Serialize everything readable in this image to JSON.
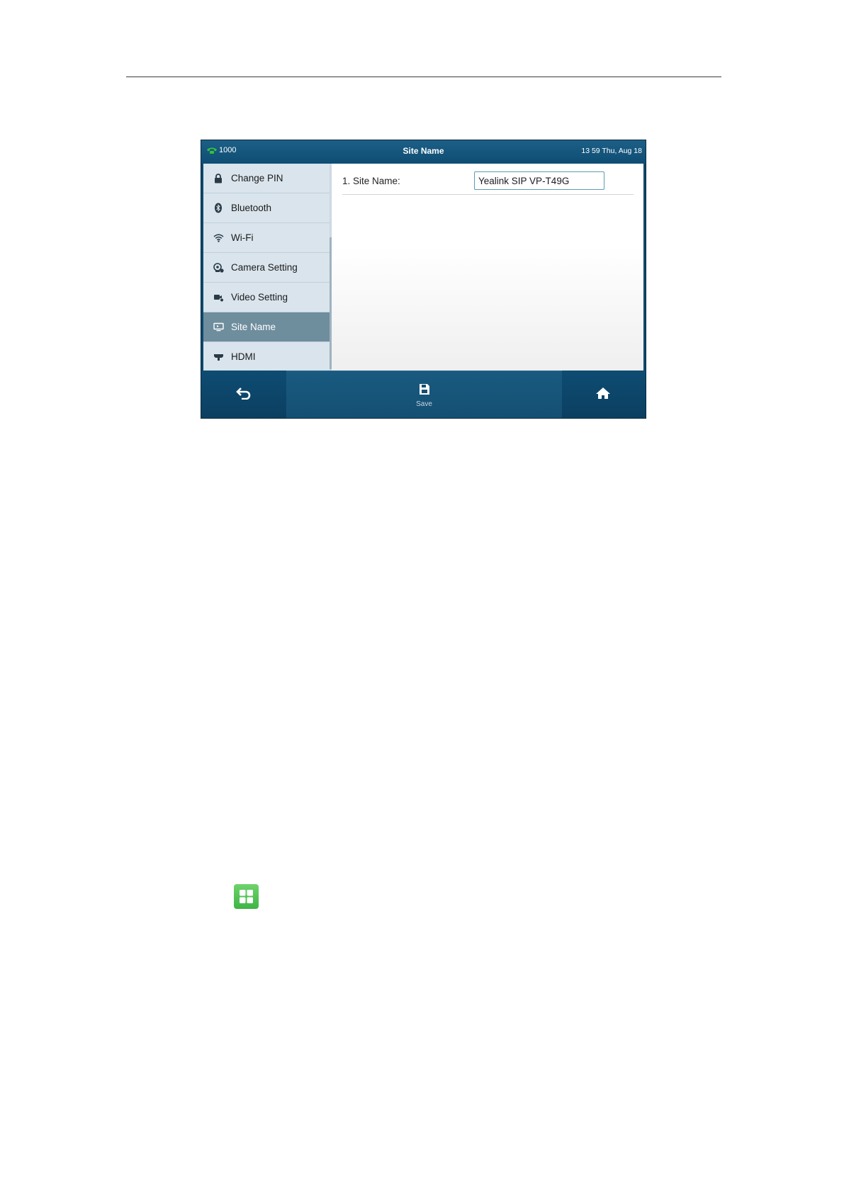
{
  "status_bar": {
    "line_number": "1000",
    "title": "Site Name",
    "datetime": "13 59 Thu, Aug 18"
  },
  "sidebar": {
    "items": [
      {
        "label": "Change PIN",
        "icon": "lock-icon"
      },
      {
        "label": "Bluetooth",
        "icon": "bluetooth-icon"
      },
      {
        "label": "Wi-Fi",
        "icon": "wifi-icon"
      },
      {
        "label": "Camera Setting",
        "icon": "camera-icon"
      },
      {
        "label": "Video Setting",
        "icon": "video-icon"
      },
      {
        "label": "Site Name",
        "icon": "monitor-icon",
        "active": true
      },
      {
        "label": "HDMI",
        "icon": "hdmi-icon"
      }
    ]
  },
  "form": {
    "site_name_label": "1. Site Name:",
    "site_name_value": "Yealink SIP VP-T49G"
  },
  "softkeys": {
    "back_icon": "back-arrow-icon",
    "save_label": "Save",
    "home_icon": "home-icon"
  },
  "colors": {
    "frame": "#0d4a6f",
    "active_item": "#6e8d9d",
    "sidebar": "#d9e4ec",
    "input_border": "#5c9bb3",
    "apps_icon": "#4cbf4f"
  }
}
